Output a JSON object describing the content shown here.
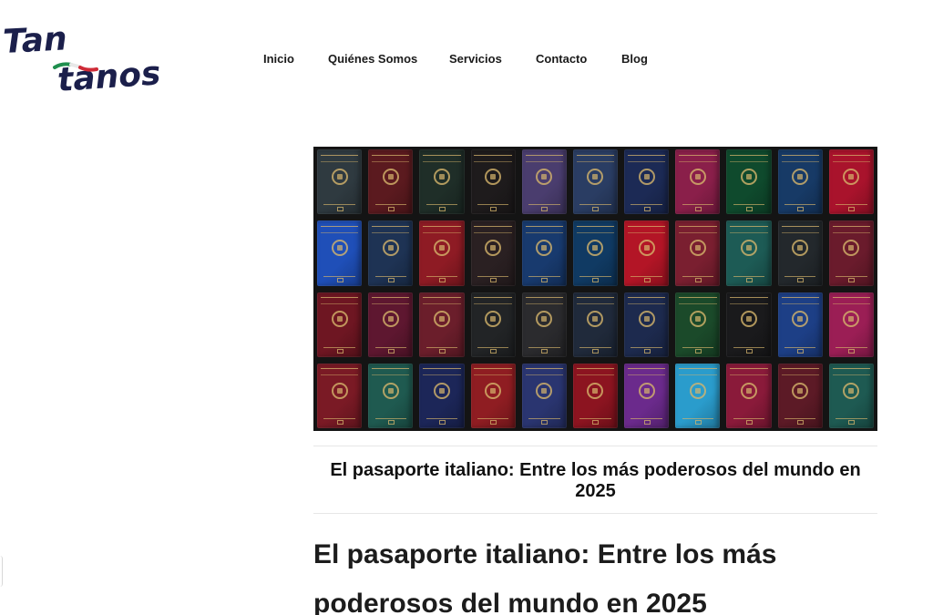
{
  "brand": {
    "logo_line1": "Tan",
    "logo_line2": "tanos",
    "text_color": "#1b1f4b",
    "flag_colors": [
      "#1f8f4e",
      "#ffffff",
      "#cf2b37"
    ]
  },
  "nav": {
    "items": [
      {
        "label": "Inicio"
      },
      {
        "label": "Quiénes Somos"
      },
      {
        "label": "Servicios"
      },
      {
        "label": "Contacto"
      },
      {
        "label": "Blog"
      }
    ]
  },
  "hero": {
    "description": "",
    "passport_colors": [
      [
        "#2f3a40",
        "#5b1a1f",
        "#1f2e28",
        "#1e1b1c",
        "#4a3d6e",
        "#2a3d63",
        "#1c2a55",
        "#8a1f4a",
        "#0f4a2d",
        "#173a66",
        "#a9132c"
      ],
      [
        "#1f4fb8",
        "#1e3354",
        "#8e1b24",
        "#2a2022",
        "#183a6e",
        "#103a63",
        "#b31526",
        "#7a1f30",
        "#1d5b55",
        "#23282c",
        "#6a1b2c"
      ],
      [
        "#6e1622",
        "#5e1730",
        "#6b1e2b",
        "#222426",
        "#2b2b2e",
        "#202a3b",
        "#1d2a4e",
        "#1b4a2a",
        "#1a1a1c",
        "#1d3f86",
        "#9b1e55"
      ],
      [
        "#7a1a25",
        "#1f5a50",
        "#1c2658",
        "#8f1d22",
        "#2a3570",
        "#8c1420",
        "#6b2a8c",
        "#2a9ccc",
        "#8a1a3a",
        "#5c1a26",
        "#1e5a52"
      ]
    ]
  },
  "article": {
    "caption": "El pasaporte italiano: Entre los más poderosos del mundo en 2025",
    "title": "El pasaporte italiano: Entre los más poderosos del mundo en 2025"
  }
}
